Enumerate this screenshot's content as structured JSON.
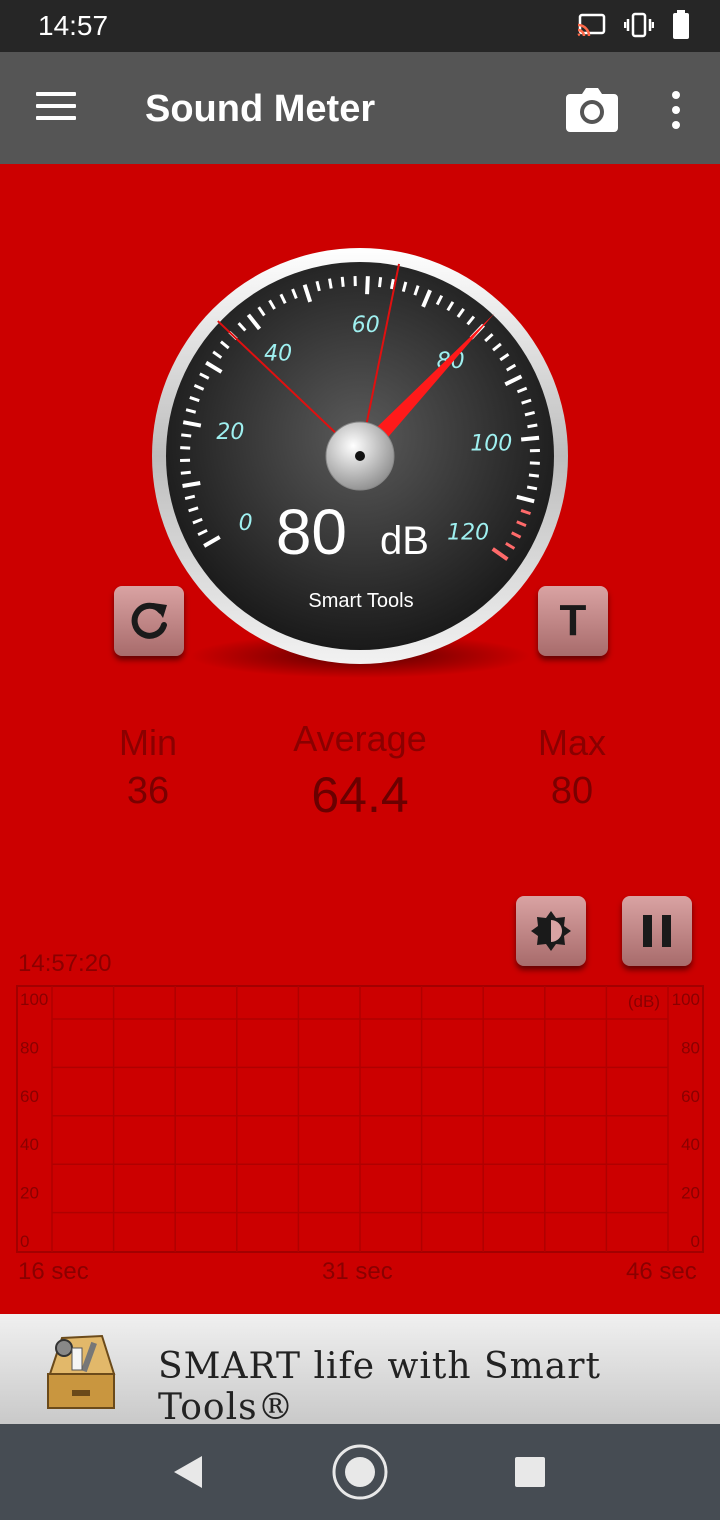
{
  "status": {
    "time": "14:57"
  },
  "app": {
    "title": "Sound Meter"
  },
  "gauge": {
    "reading": "80",
    "unit": "dB",
    "brand": "Smart Tools",
    "scale_labels": [
      "0",
      "20",
      "40",
      "60",
      "80",
      "100",
      "120"
    ],
    "needle_value": 80,
    "min_marker_value": 36,
    "avg_marker_value": 64.4
  },
  "buttons": {
    "reset_icon": "refresh-icon",
    "t_label": "T"
  },
  "stats": {
    "min_label": "Min",
    "min_value": "36",
    "avg_label": "Average",
    "avg_value": "64.4",
    "max_label": "Max",
    "max_value": "80"
  },
  "chart_data": {
    "type": "line",
    "timestamp": "14:57:20",
    "unit_label": "(dB)",
    "y_ticks": [
      "100",
      "80",
      "60",
      "40",
      "20",
      "0"
    ],
    "x_labels": [
      "16 sec",
      "31 sec",
      "46 sec"
    ],
    "ylim": [
      0,
      100
    ],
    "grid": true,
    "series": []
  },
  "banner": {
    "text": "SMART life with Smart Tools®"
  },
  "colors": {
    "background": "#cc0000",
    "appbar": "#555555",
    "accent": "#ff2020"
  }
}
